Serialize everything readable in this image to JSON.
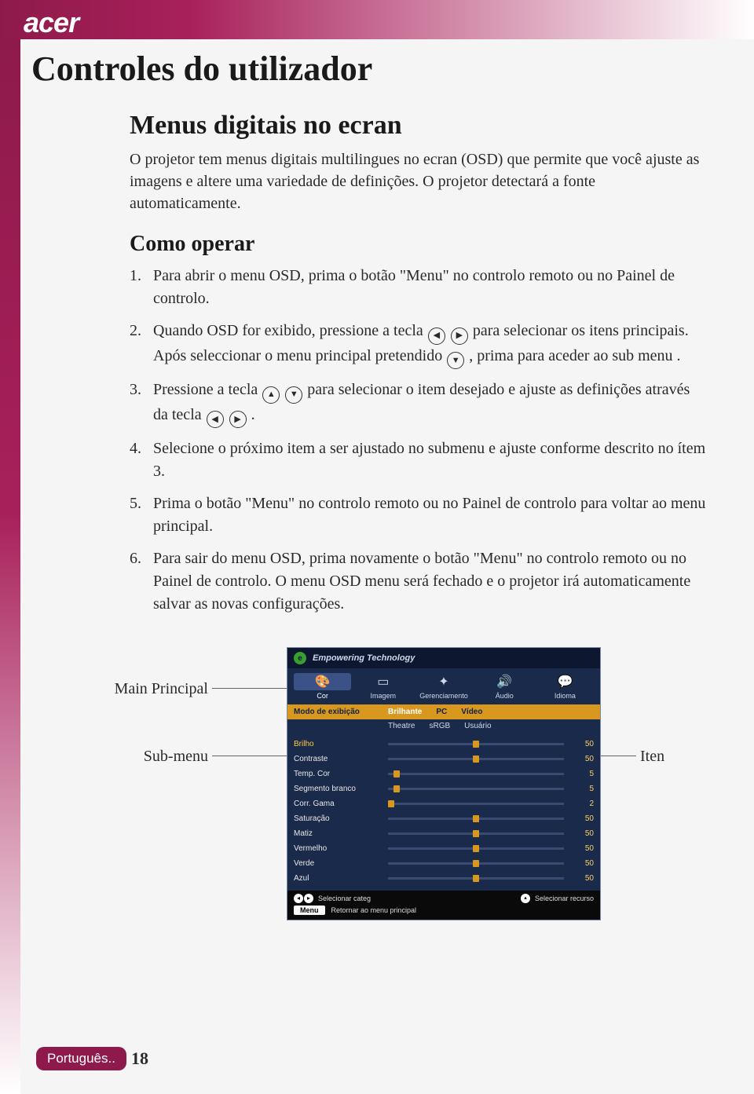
{
  "brand": "acer",
  "doc_title": "Controles do utilizador",
  "section_heading": "Menus digitais no ecran",
  "intro": "O projetor tem menus digitais multilingues no ecran (OSD) que permite que você ajuste as imagens e altere uma variedade de definições. O projetor detectará a fonte automaticamente.",
  "sub_heading": "Como operar",
  "steps": {
    "n1": "1.",
    "t1": "Para abrir o menu OSD, prima o botão \"Menu\" no controlo remoto ou no Painel de controlo.",
    "n2": "2.",
    "t2a": "Quando OSD for exibido, pressione a tecla ",
    "t2b": " para selecionar os itens principais. Após seleccionar o menu principal pretendido ",
    "t2c": " , prima  para aceder ao sub menu .",
    "n3": "3.",
    "t3a": "Pressione a tecla  ",
    "t3b": " para selecionar o item desejado e ajuste as definições através da tecla ",
    "t3c": ".",
    "n4": "4.",
    "t4": "Selecione o próximo item a ser ajustado no submenu e ajuste conforme descrito no ítem 3.",
    "n5": "5.",
    "t5": "Prima o botão \"Menu\" no controlo remoto ou no Painel de controlo para voltar ao menu principal.",
    "n6": "6.",
    "t6": "Para sair do menu OSD, prima novamente o botão \"Menu\" no controlo remoto ou no Painel de controlo. O menu OSD menu será fechado e o projetor irá automaticamente salvar as novas configurações."
  },
  "callouts": {
    "main": "Main Principal",
    "sub": "Sub-menu",
    "item": "Iten"
  },
  "osd": {
    "header_brand": "e",
    "header_text": "Empowering Technology",
    "tabs": [
      "Cor",
      "Imagem",
      "Gerenciamento",
      "Áudio",
      "Idioma"
    ],
    "mode_label": "Modo de exibição",
    "mode_row1": [
      "Brilhante",
      "PC",
      "Vídeo"
    ],
    "mode_row2": [
      "Theatre",
      "sRGB",
      "Usuário"
    ],
    "rows": [
      {
        "label": "Brilho",
        "value": 50
      },
      {
        "label": "Contraste",
        "value": 50
      },
      {
        "label": "Temp. Cor",
        "value": 5
      },
      {
        "label": "Segmento branco",
        "value": 5
      },
      {
        "label": "Corr. Gama",
        "value": 2
      },
      {
        "label": "Saturação",
        "value": 50
      },
      {
        "label": "Matiz",
        "value": 50
      },
      {
        "label": "Vermelho",
        "value": 50
      },
      {
        "label": "Verde",
        "value": 50
      },
      {
        "label": "Azul",
        "value": 50
      }
    ],
    "footer_categ": "Selecionar categ",
    "footer_recurso": "Selecionar recurso",
    "footer_menu_btn": "Menu",
    "footer_return": "Retornar ao menu principal"
  },
  "footer": {
    "language": "Português..",
    "page": "18"
  }
}
